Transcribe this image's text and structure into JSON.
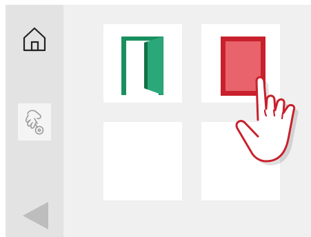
{
  "sidebar": {
    "items": [
      {
        "name": "home",
        "icon": "home-icon"
      },
      {
        "name": "assist",
        "icon": "hand-key-icon"
      },
      {
        "name": "back",
        "icon": "back-arrow-icon"
      }
    ]
  },
  "grid": {
    "tiles": [
      {
        "name": "open-door",
        "icon": "open-door-icon",
        "color": "#1a8f5e"
      },
      {
        "name": "closed-door",
        "icon": "closed-door-icon",
        "color": "#c8202c"
      },
      {
        "name": "empty",
        "icon": ""
      },
      {
        "name": "empty",
        "icon": ""
      }
    ]
  },
  "colors": {
    "green": "#1a8f5e",
    "red": "#c8202c",
    "sidebar": "#e3e3e3",
    "background": "#f0f0f0"
  }
}
